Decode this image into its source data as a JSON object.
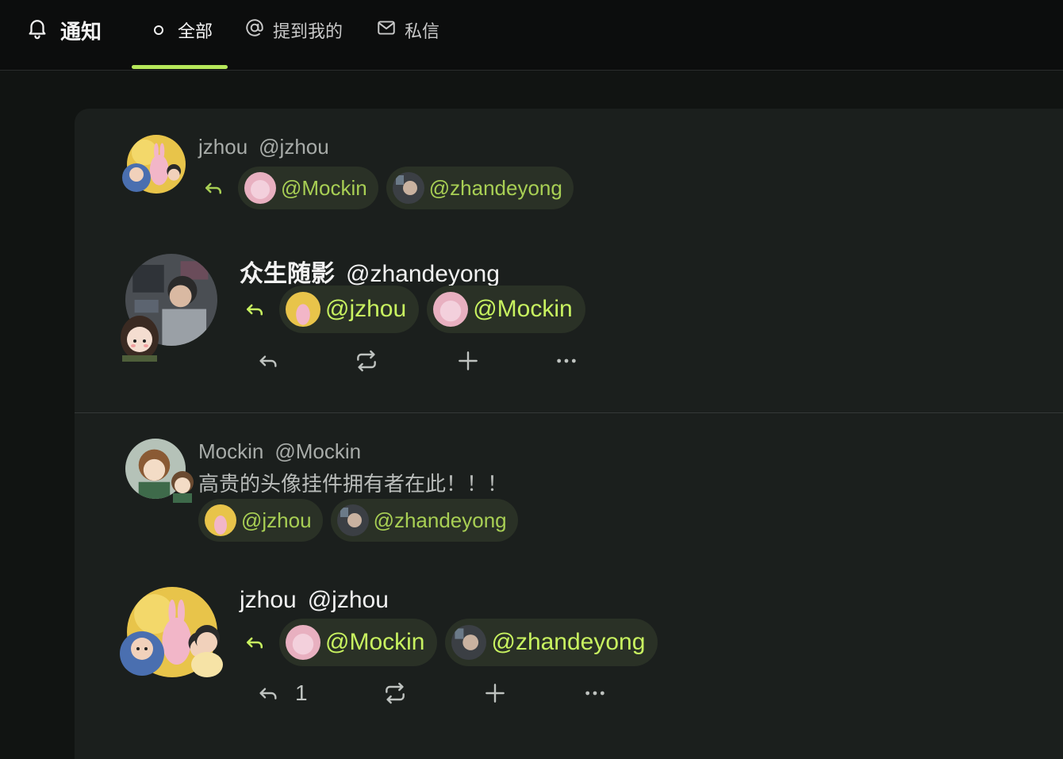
{
  "header": {
    "title": "通知",
    "tabs": [
      {
        "label": "全部",
        "active": true
      },
      {
        "label": "提到我的",
        "active": false
      },
      {
        "label": "私信",
        "active": false
      }
    ]
  },
  "accent_color": "#b6e85a",
  "notifications": [
    {
      "name": "jzhou",
      "handle": "@jzhou",
      "mentions": [
        "@Mockin",
        "@zhandeyong"
      ]
    },
    {
      "name": "众生随影",
      "handle": "@zhandeyong",
      "mentions": [
        "@jzhou",
        "@Mockin"
      ],
      "actions": {
        "reply_count": ""
      }
    },
    {
      "name": "Mockin",
      "handle": "@Mockin",
      "text": "高贵的头像挂件拥有者在此！！！",
      "mentions": [
        "@jzhou",
        "@zhandeyong"
      ]
    },
    {
      "name": "jzhou",
      "handle": "@jzhou",
      "mentions": [
        "@Mockin",
        "@zhandeyong"
      ],
      "actions": {
        "reply_count": "1"
      }
    }
  ],
  "icons": [
    "bell-icon",
    "dot-icon",
    "at-icon",
    "mail-icon",
    "reply-icon",
    "repost-icon",
    "plus-icon",
    "more-icon"
  ]
}
